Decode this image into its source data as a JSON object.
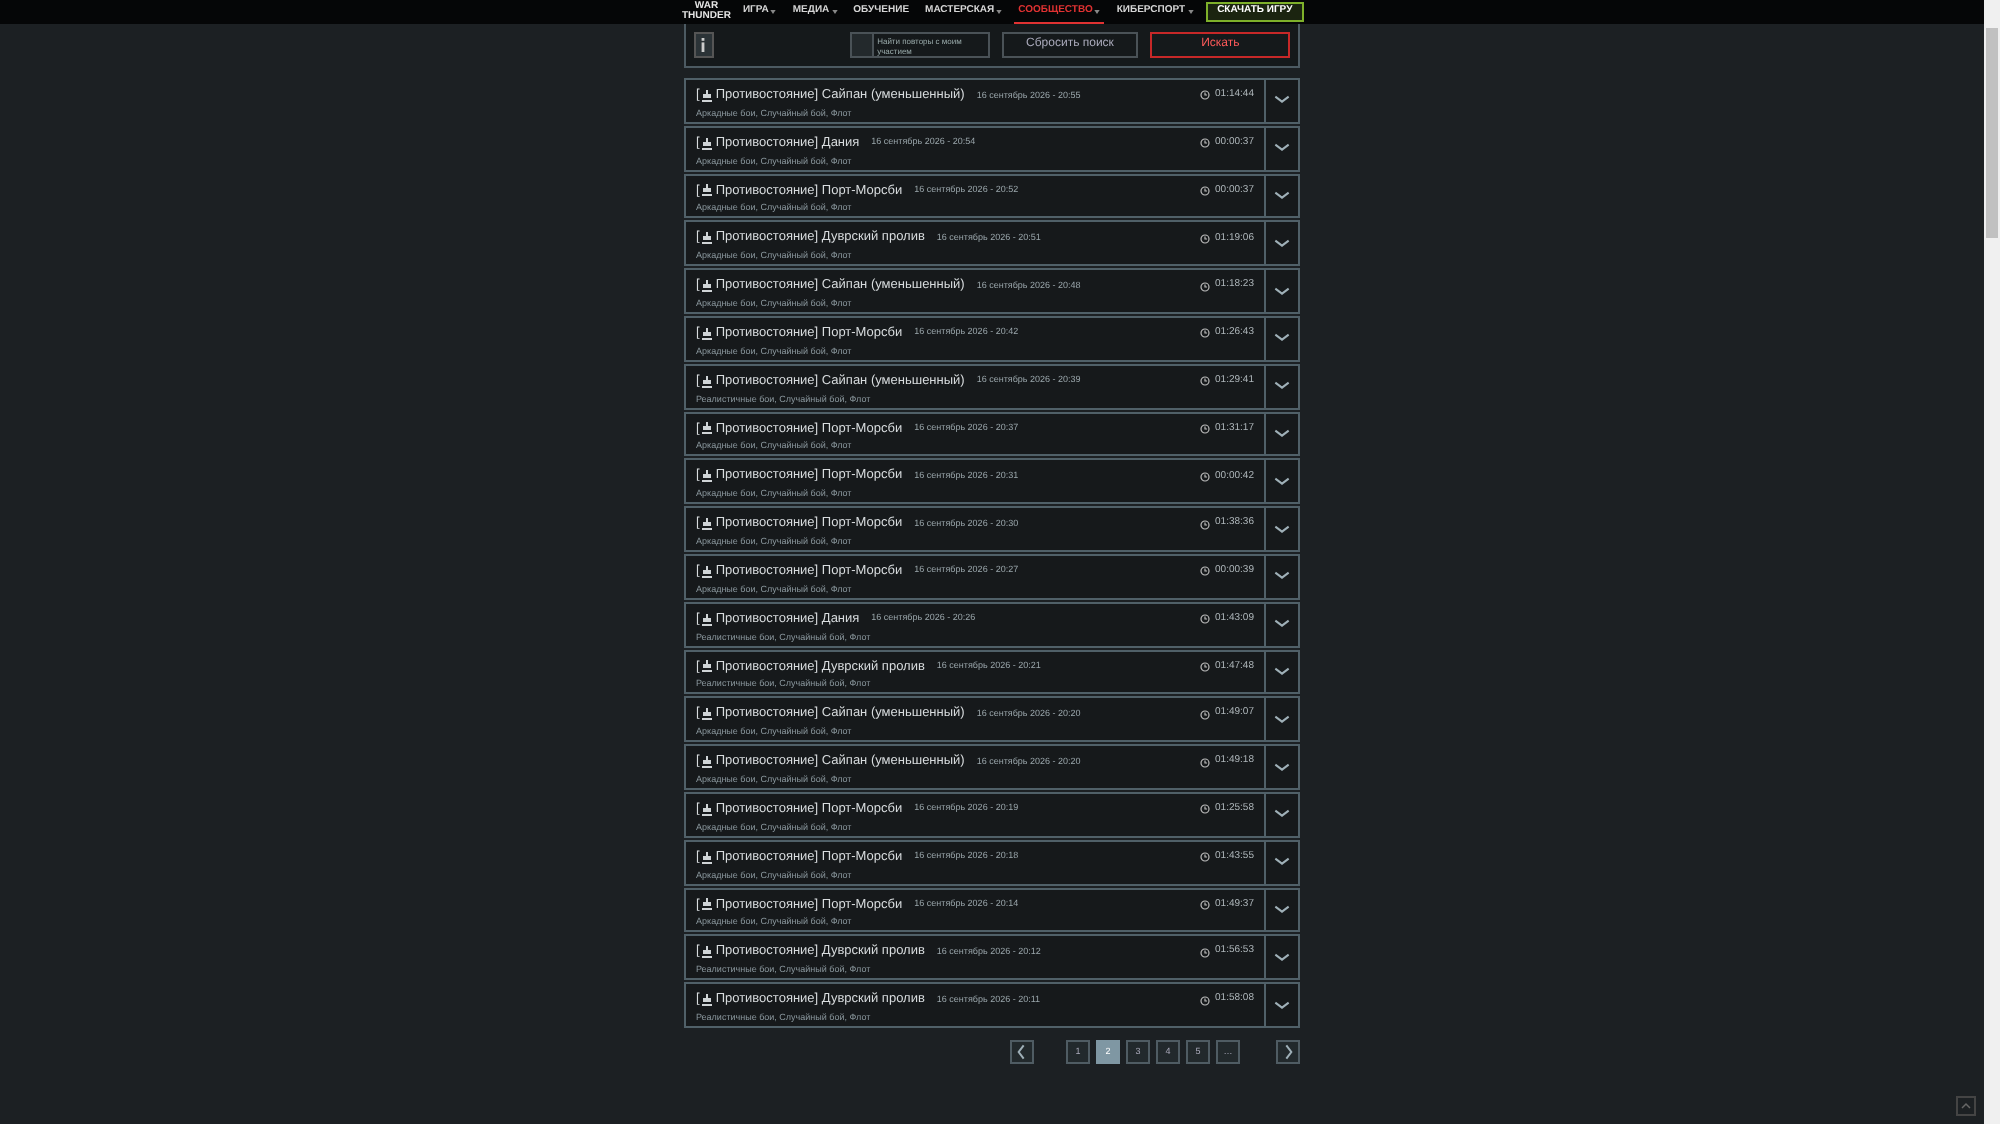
{
  "nav": {
    "logo": [
      "WAR",
      "THUNDER"
    ],
    "items": [
      {
        "label": "ИГРА",
        "dropdown": true,
        "selected": false
      },
      {
        "label": "МЕДИА",
        "dropdown": true,
        "selected": false
      },
      {
        "label": "ОБУЧЕНИЕ",
        "dropdown": false,
        "selected": false
      },
      {
        "label": "МАСТЕРСКАЯ",
        "dropdown": true,
        "selected": false
      },
      {
        "label": "СООБЩЕСТВО",
        "dropdown": true,
        "selected": true
      },
      {
        "label": "КИБЕРСПОРТ",
        "dropdown": true,
        "selected": false
      }
    ],
    "download": "СКАЧАТЬ ИГРУ"
  },
  "search": {
    "checkbox": {
      "label": "Найти повторы с моим участием",
      "checked": false
    },
    "reset": "Сбросить поиск",
    "submit": "Искать"
  },
  "replays": [
    {
      "prefix": "[",
      "title": "Противостояние] Сайпан (уменьшенный)",
      "date": "16 сентябрь 2026 - 20:55",
      "tags": "Аркадные бои, Случайный бой, Флот",
      "duration": "01:14:44"
    },
    {
      "prefix": "[",
      "title": "Противостояние] Дания",
      "date": "16 сентябрь 2026 - 20:54",
      "tags": "Аркадные бои, Случайный бой, Флот",
      "duration": "00:00:37"
    },
    {
      "prefix": "[",
      "title": "Противостояние] Порт-Морсби",
      "date": "16 сентябрь 2026 - 20:52",
      "tags": "Аркадные бои, Случайный бой, Флот",
      "duration": "00:00:37"
    },
    {
      "prefix": "[",
      "title": "Противостояние] Дуврский пролив",
      "date": "16 сентябрь 2026 - 20:51",
      "tags": "Аркадные бои, Случайный бой, Флот",
      "duration": "01:19:06"
    },
    {
      "prefix": "[",
      "title": "Противостояние] Сайпан (уменьшенный)",
      "date": "16 сентябрь 2026 - 20:48",
      "tags": "Аркадные бои, Случайный бой, Флот",
      "duration": "01:18:23"
    },
    {
      "prefix": "[",
      "title": "Противостояние] Порт-Морсби",
      "date": "16 сентябрь 2026 - 20:42",
      "tags": "Аркадные бои, Случайный бой, Флот",
      "duration": "01:26:43"
    },
    {
      "prefix": "[",
      "title": "Противостояние] Сайпан (уменьшенный)",
      "date": "16 сентябрь 2026 - 20:39",
      "tags": "Реалистичные бои, Случайный бой, Флот",
      "duration": "01:29:41"
    },
    {
      "prefix": "[",
      "title": "Противостояние] Порт-Морсби",
      "date": "16 сентябрь 2026 - 20:37",
      "tags": "Аркадные бои, Случайный бой, Флот",
      "duration": "01:31:17"
    },
    {
      "prefix": "[",
      "title": "Противостояние] Порт-Морсби",
      "date": "16 сентябрь 2026 - 20:31",
      "tags": "Аркадные бои, Случайный бой, Флот",
      "duration": "00:00:42"
    },
    {
      "prefix": "[",
      "title": "Противостояние] Порт-Морсби",
      "date": "16 сентябрь 2026 - 20:30",
      "tags": "Аркадные бои, Случайный бой, Флот",
      "duration": "01:38:36"
    },
    {
      "prefix": "[",
      "title": "Противостояние] Порт-Морсби",
      "date": "16 сентябрь 2026 - 20:27",
      "tags": "Аркадные бои, Случайный бой, Флот",
      "duration": "00:00:39"
    },
    {
      "prefix": "[",
      "title": "Противостояние] Дания",
      "date": "16 сентябрь 2026 - 20:26",
      "tags": "Реалистичные бои, Случайный бой, Флот",
      "duration": "01:43:09"
    },
    {
      "prefix": "[",
      "title": "Противостояние] Дуврский пролив",
      "date": "16 сентябрь 2026 - 20:21",
      "tags": "Реалистичные бои, Случайный бой, Флот",
      "duration": "01:47:48"
    },
    {
      "prefix": "[",
      "title": "Противостояние] Сайпан (уменьшенный)",
      "date": "16 сентябрь 2026 - 20:20",
      "tags": "Аркадные бои, Случайный бой, Флот",
      "duration": "01:49:07"
    },
    {
      "prefix": "[",
      "title": "Противостояние] Сайпан (уменьшенный)",
      "date": "16 сентябрь 2026 - 20:20",
      "tags": "Аркадные бои, Случайный бой, Флот",
      "duration": "01:49:18"
    },
    {
      "prefix": "[",
      "title": "Противостояние] Порт-Морсби",
      "date": "16 сентябрь 2026 - 20:19",
      "tags": "Аркадные бои, Случайный бой, Флот",
      "duration": "01:25:58"
    },
    {
      "prefix": "[",
      "title": "Противостояние] Порт-Морсби",
      "date": "16 сентябрь 2026 - 20:18",
      "tags": "Аркадные бои, Случайный бой, Флот",
      "duration": "01:43:55"
    },
    {
      "prefix": "[",
      "title": "Противостояние] Порт-Морсби",
      "date": "16 сентябрь 2026 - 20:14",
      "tags": "Аркадные бои, Случайный бой, Флот",
      "duration": "01:49:37"
    },
    {
      "prefix": "[",
      "title": "Противостояние] Дуврский пролив",
      "date": "16 сентябрь 2026 - 20:12",
      "tags": "Реалистичные бои, Случайный бой, Флот",
      "duration": "01:56:53"
    },
    {
      "prefix": "[",
      "title": "Противостояние] Дуврский пролив",
      "date": "16 сентябрь 2026 - 20:11",
      "tags": "Реалистичные бои, Случайный бой, Флот",
      "duration": "01:58:08"
    }
  ],
  "pagination": {
    "pages": [
      {
        "label": "1",
        "selected": false
      },
      {
        "label": "2",
        "selected": true
      },
      {
        "label": "3",
        "selected": false
      },
      {
        "label": "4",
        "selected": false
      },
      {
        "label": "5",
        "selected": false
      },
      {
        "label": "…",
        "selected": false
      }
    ]
  }
}
